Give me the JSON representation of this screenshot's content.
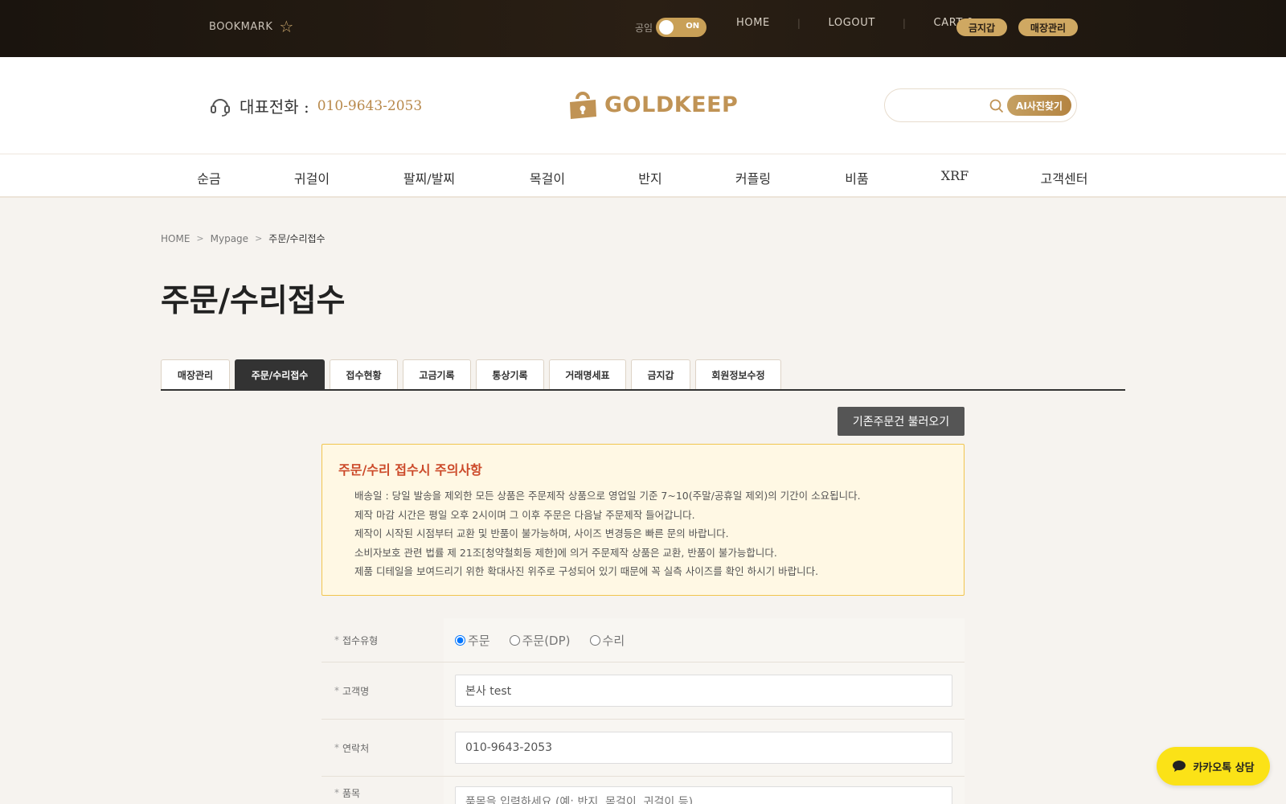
{
  "topbar": {
    "bookmark_label": "BOOKMARK",
    "toggle_label": "공임",
    "toggle_state": "ON",
    "nav": [
      "HOME",
      "LOGOUT",
      "CART 0"
    ],
    "pill_1": "금지갑",
    "pill_2": "매장관리"
  },
  "header": {
    "phone_title": "대표전화 :",
    "phone_number": "010-9643-2053",
    "logo_text": "GOLDKEEP",
    "search_placeholder": "",
    "ai_button": "AI사진찾기"
  },
  "mainnav": [
    "순금",
    "귀걸이",
    "팔찌/발찌",
    "목걸이",
    "반지",
    "커플링",
    "비품",
    "XRF",
    "고객센터"
  ],
  "breadcrumb": [
    "HOME",
    "Mypage",
    "주문/수리접수"
  ],
  "page_title": "주문/수리접수",
  "tabs": [
    {
      "label": "매장관리",
      "active": false
    },
    {
      "label": "주문/수리접수",
      "active": true
    },
    {
      "label": "접수현황",
      "active": false
    },
    {
      "label": "고금기록",
      "active": false
    },
    {
      "label": "통상기록",
      "active": false
    },
    {
      "label": "거래명세표",
      "active": false
    },
    {
      "label": "금지갑",
      "active": false
    },
    {
      "label": "회원정보수정",
      "active": false
    }
  ],
  "load_button": "기존주문건 불러오기",
  "notice": {
    "title": "주문/수리 접수시 주의사항",
    "lines": [
      "배송일 : 당일 발송을 제외한 모든 상품은 주문제작 상품으로 영업일 기준 7~10(주말/공휴일 제외)의 기간이 소요됩니다.",
      "제작 마감 시간은 평일 오후 2시이며 그 이후 주문은 다음날 주문제작 들어갑니다.",
      "제작이 시작된 시점부터 교환 및 반품이 불가능하며, 사이즈 변경등은 빠른 문의 바랍니다.",
      "소비자보호 관련 법률 제 21조[청약철회등 제한]에 의거 주문제작 상품은 교환, 반품이 불가능합니다.",
      "제품 디테일을 보여드리기 위한 확대사진 위주로 구성되어 있기 때문에 꼭 실측 사이즈를 확인 하시기 바랍니다."
    ]
  },
  "form": {
    "type_label": "접수유형",
    "type_options": [
      "주문",
      "주문(DP)",
      "수리"
    ],
    "type_selected": "주문",
    "customer_label": "고객명",
    "customer_value": "본사 test",
    "contact_label": "연락처",
    "contact_value": "010-9643-2053",
    "item_label": "품목",
    "item_placeholder": "품목을 입력하세요 (예: 반지, 목걸이, 귀걸이 등)"
  },
  "kakao_label": "카카오톡 상담",
  "colors": {
    "accent": "#c09355",
    "notice_title": "#cc4a2a",
    "kakao": "#fbe217"
  }
}
